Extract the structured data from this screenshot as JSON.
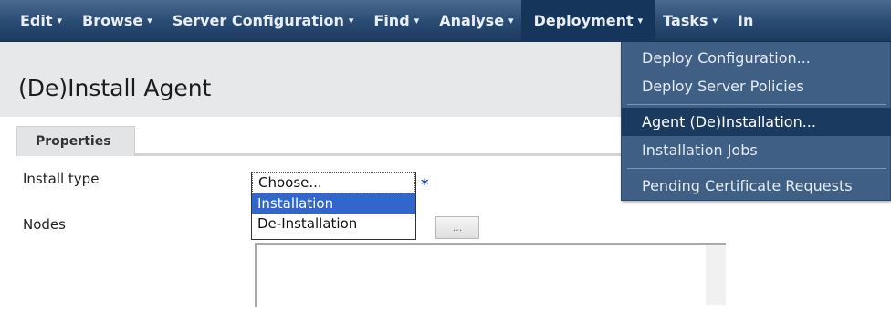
{
  "menubar": {
    "items": [
      {
        "label": "Edit"
      },
      {
        "label": "Browse"
      },
      {
        "label": "Server Configuration"
      },
      {
        "label": "Find"
      },
      {
        "label": "Analyse"
      },
      {
        "label": "Deployment"
      },
      {
        "label": "Tasks"
      },
      {
        "label": "In"
      }
    ],
    "caret": "▾"
  },
  "deployment_menu": {
    "items": [
      {
        "label": "Deploy Configuration..."
      },
      {
        "label": "Deploy Server Policies"
      },
      {
        "label": "Agent (De)Installation..."
      },
      {
        "label": "Installation Jobs"
      },
      {
        "label": "Pending Certificate Requests"
      }
    ],
    "highlighted": "Agent (De)Installation..."
  },
  "page": {
    "title": "(De)Install Agent",
    "tab": "Properties"
  },
  "form": {
    "install_type_label": "Install type",
    "required_mark": "*",
    "nodes_label": "Nodes",
    "nodes_button": "...",
    "install_type_options": [
      "Choose...",
      "Installation",
      "De-Installation"
    ],
    "install_type_selected": "Installation"
  },
  "colors": {
    "menubar": "#294a72",
    "dropdown": "#3f5f84",
    "dropdown_highlight": "#1b3a5f",
    "select_highlight": "#3366cc",
    "header_band": "#e7e8e9"
  }
}
